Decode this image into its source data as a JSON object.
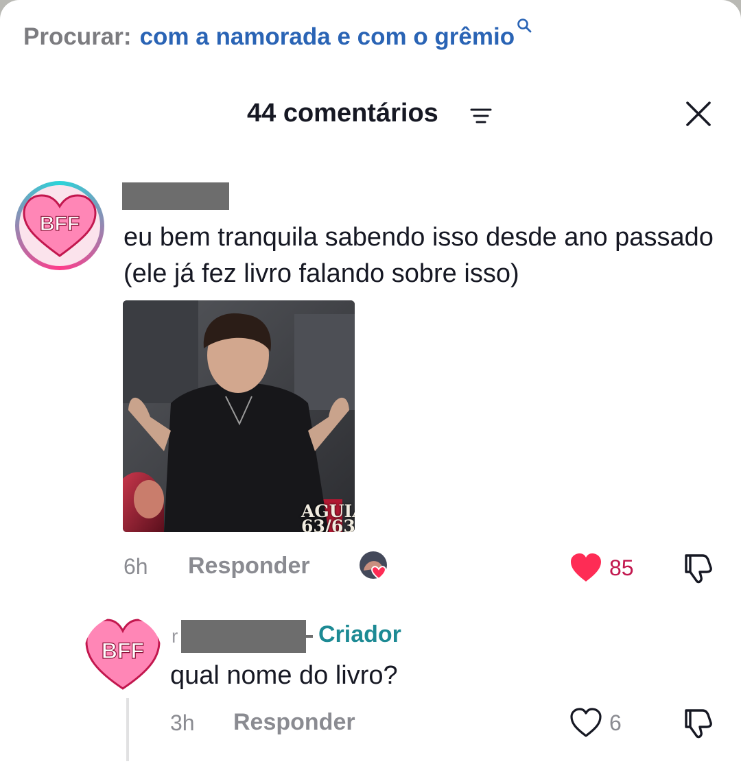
{
  "search": {
    "prefix": "Procurar:",
    "query": "com a namorada e com o grêmio"
  },
  "header": {
    "comment_count": "44 comentários"
  },
  "comments": [
    {
      "username": "",
      "avatar_badge": "BFF",
      "text": "eu bem tranquila sabendo isso desde ano passado (ele já fez livro falando sobre isso)",
      "image_caption_line1": "AGUIAR",
      "image_caption_line2": "63/63",
      "time": "6h",
      "reply_label": "Responder",
      "likes": "85",
      "liked": true,
      "liked_by_creator": true
    },
    {
      "username_stub": "r",
      "creator_label": "Criador",
      "avatar_badge": "BFF",
      "text": "qual nome do livro?",
      "time": "3h",
      "reply_label": "Responder",
      "likes": "6",
      "liked": false
    }
  ],
  "colors": {
    "link_blue": "#2a64b5",
    "like_red": "#fe2c55",
    "creator_teal": "#1d8a94",
    "muted_gray": "#8a8b91"
  },
  "icons": [
    "search-icon",
    "sort-icon",
    "close-icon",
    "heart-icon",
    "dislike-icon",
    "bff-heart-icon"
  ]
}
